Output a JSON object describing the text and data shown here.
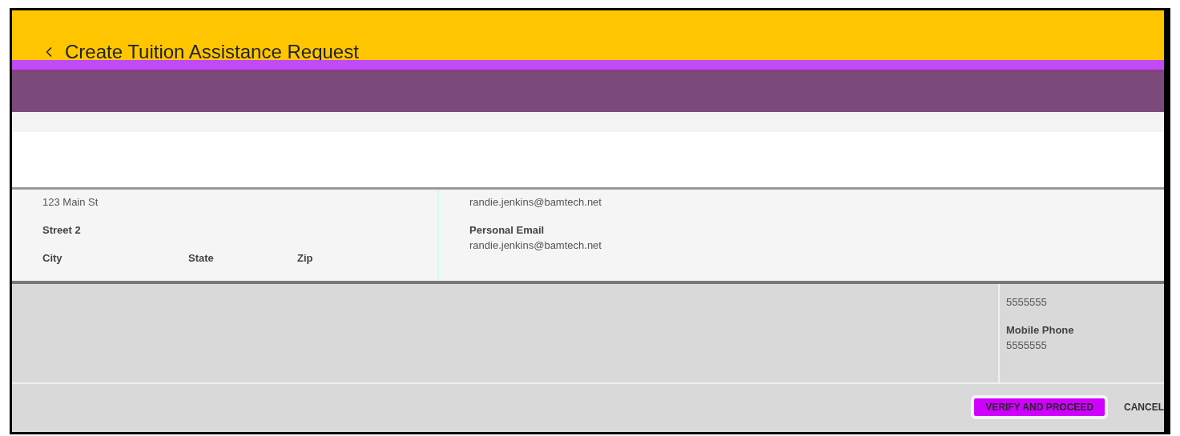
{
  "header": {
    "title": "Create Tuition Assistance Request"
  },
  "address": {
    "street_1_value": "123 Main St",
    "street_2_label": "Street 2",
    "columns": [
      {
        "label": "City"
      },
      {
        "label": "State"
      },
      {
        "label": "Zip"
      }
    ]
  },
  "contact": {
    "email_value": "randie.jenkins@bamtech.net",
    "fields": [
      {
        "label": "Personal Email",
        "value": "randie.jenkins@bamtech.net"
      }
    ]
  },
  "phones": {
    "work_phone_value": "5555555",
    "fields": [
      {
        "label": "Mobile Phone",
        "value": "5555555"
      }
    ]
  },
  "buttons": [
    {
      "label": "VERIFY AND PROCEED",
      "kind": "primary"
    },
    {
      "label": "CANCEL",
      "kind": "text"
    }
  ]
}
